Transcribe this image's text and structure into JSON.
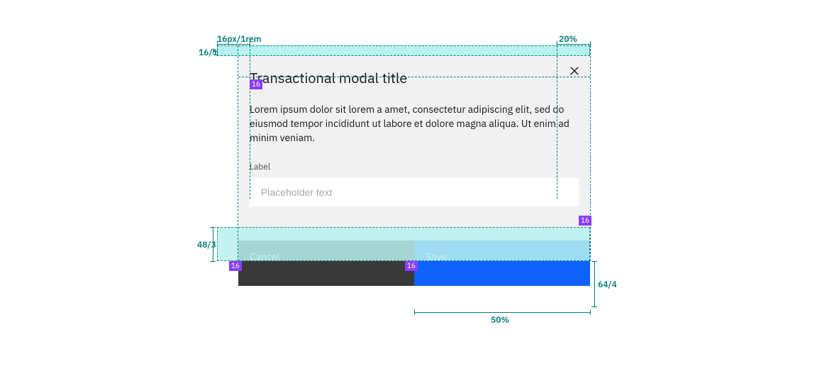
{
  "modal": {
    "title": "Transactional modal title",
    "description": "Lorem ipsum dolor sit lorem a amet, consectetur adipiscing elit, sed do eiusmod tempor incididunt ut labore et dolore magna aliqua. Ut enim ad minim veniam.",
    "field_label": "Label",
    "input_placeholder": "Placeholder text",
    "cancel_label": "Cancel",
    "save_label": "Save"
  },
  "spec": {
    "badge_under_title": "16",
    "badge_input_right": "16",
    "badge_cancel": "16",
    "badge_save": "16",
    "dim_left_padding": "16px/1rem",
    "dim_top_small": "16/1",
    "dim_close_offset": "20%",
    "dim_gap_height": "48/3",
    "dim_button_height": "64/4",
    "dim_button_width": "50%"
  },
  "colors": {
    "overlay_fill": "#b8f2ef",
    "overlay_stroke": "#008080",
    "badge": "#8a3ffc",
    "teal_text": "#007d79",
    "cancel_bg": "#393939",
    "save_bg": "#0f62fe"
  }
}
